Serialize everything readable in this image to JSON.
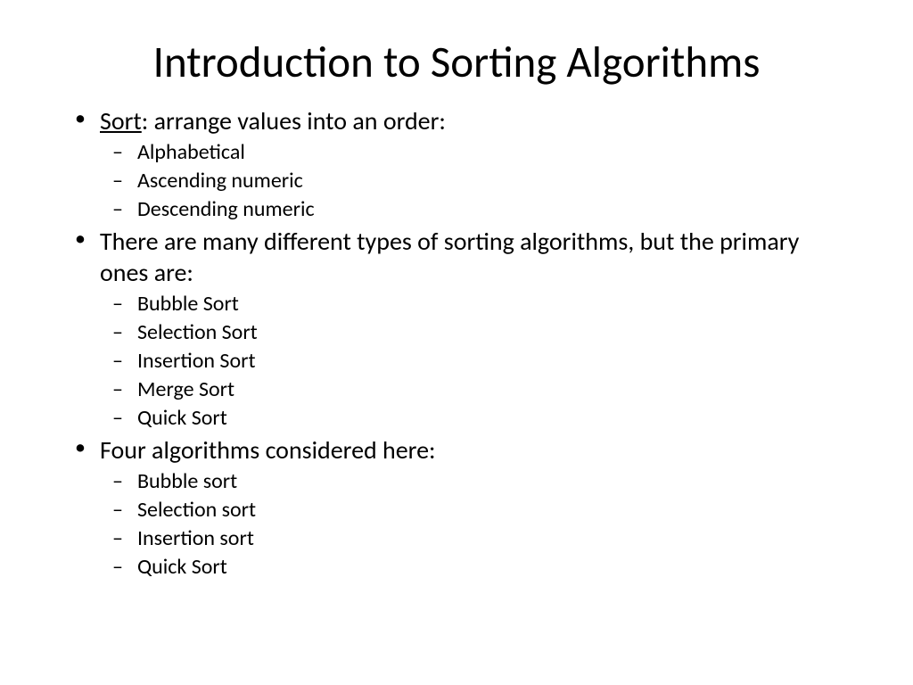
{
  "title": "Introduction to Sorting Algorithms",
  "bullet1": {
    "keyword": "Sort",
    "rest": ": arrange values into an order:",
    "sub": [
      "Alphabetical",
      "Ascending numeric",
      "Descending numeric"
    ]
  },
  "bullet2": {
    "text": "There are many different types of sorting algorithms, but the primary ones are:",
    "sub": [
      "Bubble Sort",
      "Selection Sort",
      "Insertion Sort",
      "Merge Sort",
      "Quick Sort"
    ]
  },
  "bullet3": {
    "text": "Four algorithms considered here:",
    "sub": [
      "Bubble sort",
      "Selection sort",
      "Insertion sort",
      "Quick Sort"
    ]
  }
}
